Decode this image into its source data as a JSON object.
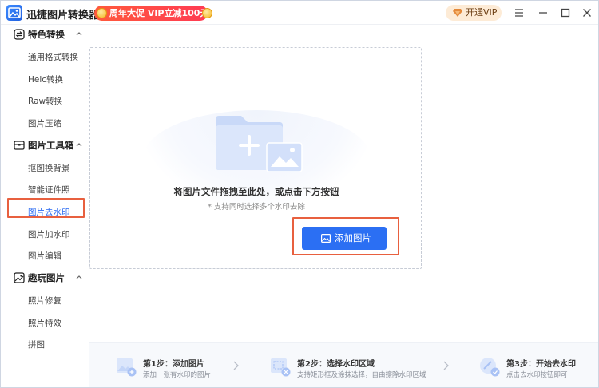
{
  "app": {
    "title": "迅捷图片转换器"
  },
  "promo": {
    "label": "周年大促 VIP立减100元"
  },
  "vip": {
    "label": "开通VIP"
  },
  "window_controls": [
    "menu-icon",
    "minimize-icon",
    "maximize-icon",
    "close-icon"
  ],
  "sidebar": {
    "groups": [
      {
        "label": "特色转换",
        "icon": "convert-icon",
        "items": [
          "通用格式转换",
          "Heic转换",
          "Raw转换",
          "图片压缩"
        ]
      },
      {
        "label": "图片工具箱",
        "icon": "toolbox-icon",
        "items": [
          "抠图换背景",
          "智能证件照",
          "图片去水印",
          "图片加水印",
          "图片编辑"
        ]
      },
      {
        "label": "趣玩图片",
        "icon": "fun-image-icon",
        "items": [
          "照片修复",
          "照片特效",
          "拼图"
        ]
      }
    ],
    "active_item": "图片去水印"
  },
  "dropzone": {
    "title": "将图片文件拖拽至此处，或点击下方按钮",
    "hint": "* 支持同时选择多个水印去除",
    "button_label": "添加图片"
  },
  "steps": [
    {
      "title": "第1步：添加图片",
      "desc": "添加一张有水印的图片",
      "icon": "add-image-step-icon"
    },
    {
      "title": "第2步：选择水印区域",
      "desc": "支持矩形框及涂抹选择，自由擦除水印区域",
      "icon": "select-area-step-icon"
    },
    {
      "title": "第3步：开始去水印",
      "desc": "点击去水印按钮即可",
      "icon": "remove-watermark-step-icon"
    }
  ],
  "colors": {
    "accent": "#2b6ff3",
    "highlight": "#e8603f",
    "promo": "#ff4548",
    "vip_bg": "#fdebd6"
  }
}
